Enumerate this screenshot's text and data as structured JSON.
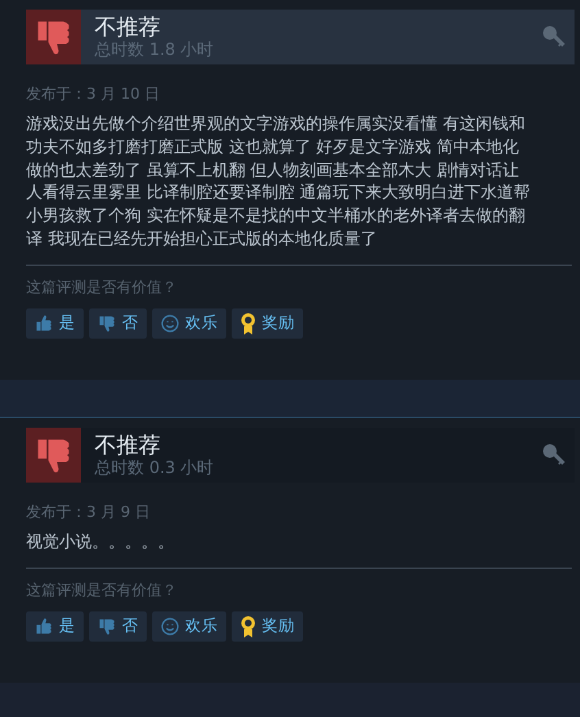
{
  "reviews": [
    {
      "verdict": "不推荐",
      "hours": "总时数 1.8 小时",
      "highlighted": true,
      "posted": "发布于：3 月 10 日",
      "body": "游戏没出先做个介绍世界观的文字游戏的操作属实没看懂 有这闲钱和功夫不如多打磨打磨正式版 这也就算了 好歹是文字游戏 简中本地化做的也太差劲了 虽算不上机翻 但人物刻画基本全部木大 剧情对话让人看得云里雾里 比译制腔还要译制腔 通篇玩下来大致明白进下水道帮小男孩救了个狗 实在怀疑是不是找的中文半桶水的老外译者去做的翻译 我现在已经先开始担心正式版的本地化质量了",
      "question": "这篇评测是否有价值？",
      "actions": [
        {
          "kind": "yes",
          "label": "是"
        },
        {
          "kind": "no",
          "label": "否"
        },
        {
          "kind": "funny",
          "label": "欢乐"
        },
        {
          "kind": "award",
          "label": "奖励"
        }
      ]
    },
    {
      "verdict": "不推荐",
      "hours": "总时数 0.3 小时",
      "highlighted": false,
      "posted": "发布于：3 月 9 日",
      "body": "视觉小说。。。。。",
      "question": "这篇评测是否有价值？",
      "actions": [
        {
          "kind": "yes",
          "label": "是"
        },
        {
          "kind": "no",
          "label": "否"
        },
        {
          "kind": "funny",
          "label": "欢乐"
        },
        {
          "kind": "award",
          "label": "奖励"
        }
      ]
    }
  ]
}
